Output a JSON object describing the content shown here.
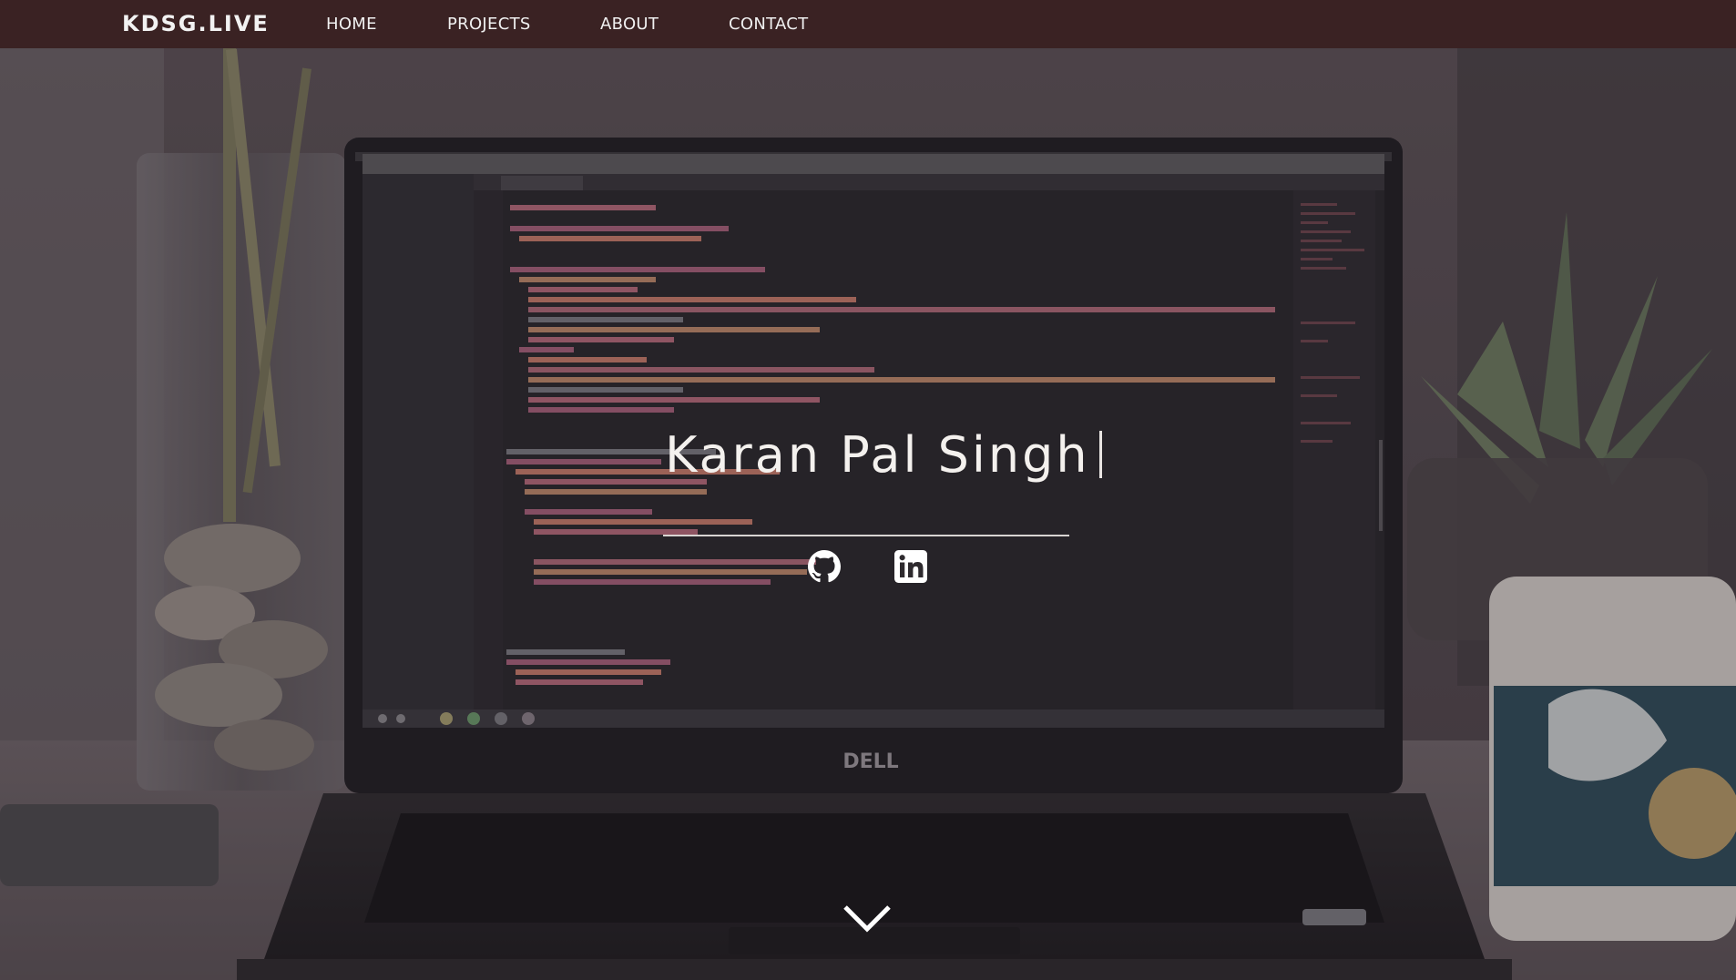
{
  "nav": {
    "brand": "KDSG.LIVE",
    "links": [
      {
        "label": "HOME"
      },
      {
        "label": "PROJECTS"
      },
      {
        "label": "ABOUT"
      },
      {
        "label": "CONTACT"
      }
    ]
  },
  "hero": {
    "name": "Karan Pal Singh",
    "laptop_logo": "DELL",
    "social": [
      {
        "icon": "github-icon"
      },
      {
        "icon": "linkedin-icon"
      }
    ],
    "scroll_icon": "chevron-down-icon"
  },
  "colors": {
    "navbar": "#3a2223",
    "hero_text": "#f4f1ee",
    "code_background": "#262429"
  }
}
